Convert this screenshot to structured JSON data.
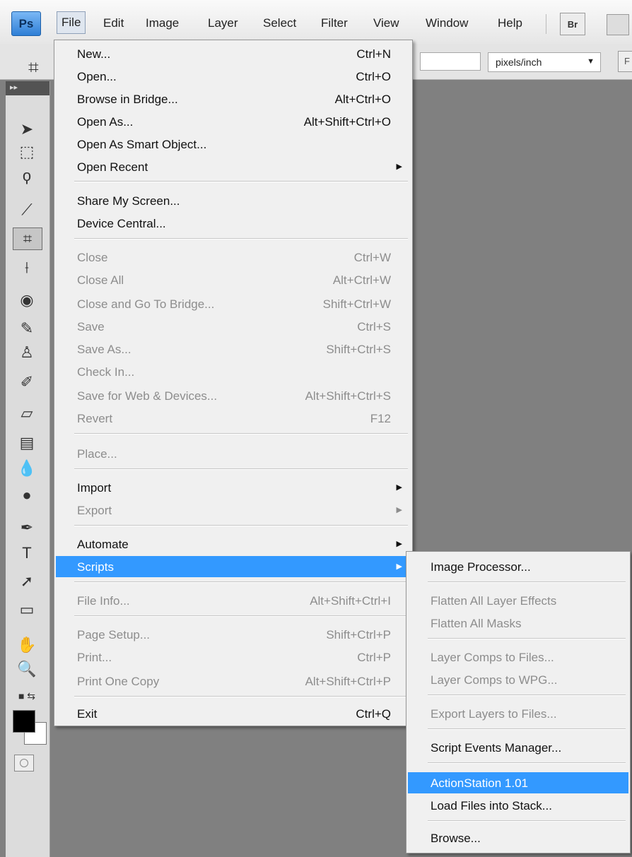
{
  "app": {
    "logo": "Ps",
    "menubar": [
      "File",
      "Edit",
      "Image",
      "Layer",
      "Select",
      "Filter",
      "View",
      "Window",
      "Help"
    ],
    "bridge_button": "Br"
  },
  "options_bar": {
    "units_value": "pixels/inch",
    "right_button": "F"
  },
  "file_menu": {
    "items": [
      {
        "label": "New...",
        "shortcut": "Ctrl+N",
        "enabled": true
      },
      {
        "label": "Open...",
        "shortcut": "Ctrl+O",
        "enabled": true
      },
      {
        "label": "Browse in Bridge...",
        "shortcut": "Alt+Ctrl+O",
        "enabled": true
      },
      {
        "label": "Open As...",
        "shortcut": "Alt+Shift+Ctrl+O",
        "enabled": true
      },
      {
        "label": "Open As Smart Object...",
        "shortcut": "",
        "enabled": true
      },
      {
        "label": "Open Recent",
        "shortcut": "",
        "enabled": true,
        "submenu": true
      },
      {
        "label": "Share My Screen...",
        "shortcut": "",
        "enabled": true
      },
      {
        "label": "Device Central...",
        "shortcut": "",
        "enabled": true
      },
      {
        "label": "Close",
        "shortcut": "Ctrl+W",
        "enabled": false
      },
      {
        "label": "Close All",
        "shortcut": "Alt+Ctrl+W",
        "enabled": false
      },
      {
        "label": "Close and Go To Bridge...",
        "shortcut": "Shift+Ctrl+W",
        "enabled": false
      },
      {
        "label": "Save",
        "shortcut": "Ctrl+S",
        "enabled": false
      },
      {
        "label": "Save As...",
        "shortcut": "Shift+Ctrl+S",
        "enabled": false
      },
      {
        "label": "Check In...",
        "shortcut": "",
        "enabled": false
      },
      {
        "label": "Save for Web & Devices...",
        "shortcut": "Alt+Shift+Ctrl+S",
        "enabled": false
      },
      {
        "label": "Revert",
        "shortcut": "F12",
        "enabled": false
      },
      {
        "label": "Place...",
        "shortcut": "",
        "enabled": false
      },
      {
        "label": "Import",
        "shortcut": "",
        "enabled": true,
        "submenu": true
      },
      {
        "label": "Export",
        "shortcut": "",
        "enabled": false,
        "submenu": true
      },
      {
        "label": "Automate",
        "shortcut": "",
        "enabled": true,
        "submenu": true
      },
      {
        "label": "Scripts",
        "shortcut": "",
        "enabled": true,
        "submenu": true,
        "highlighted": true
      },
      {
        "label": "File Info...",
        "shortcut": "Alt+Shift+Ctrl+I",
        "enabled": false
      },
      {
        "label": "Page Setup...",
        "shortcut": "Shift+Ctrl+P",
        "enabled": false
      },
      {
        "label": "Print...",
        "shortcut": "Ctrl+P",
        "enabled": false
      },
      {
        "label": "Print One Copy",
        "shortcut": "Alt+Shift+Ctrl+P",
        "enabled": false
      },
      {
        "label": "Exit",
        "shortcut": "Ctrl+Q",
        "enabled": true
      }
    ]
  },
  "scripts_menu": {
    "items": [
      {
        "label": "Image Processor...",
        "enabled": true
      },
      {
        "label": "Flatten All Layer Effects",
        "enabled": false
      },
      {
        "label": "Flatten All Masks",
        "enabled": false
      },
      {
        "label": "Layer Comps to Files...",
        "enabled": false
      },
      {
        "label": "Layer Comps to WPG...",
        "enabled": false
      },
      {
        "label": "Export Layers to Files...",
        "enabled": false
      },
      {
        "label": "Script Events Manager...",
        "enabled": true
      },
      {
        "label": "ActionStation 1.01",
        "enabled": true,
        "highlighted": true
      },
      {
        "label": "Load Files into Stack...",
        "enabled": true
      },
      {
        "label": "Browse...",
        "enabled": true
      }
    ]
  },
  "colors": {
    "highlight": "#3399ff",
    "disabled_text": "#8d8d8d",
    "canvas_bg": "#808080"
  }
}
